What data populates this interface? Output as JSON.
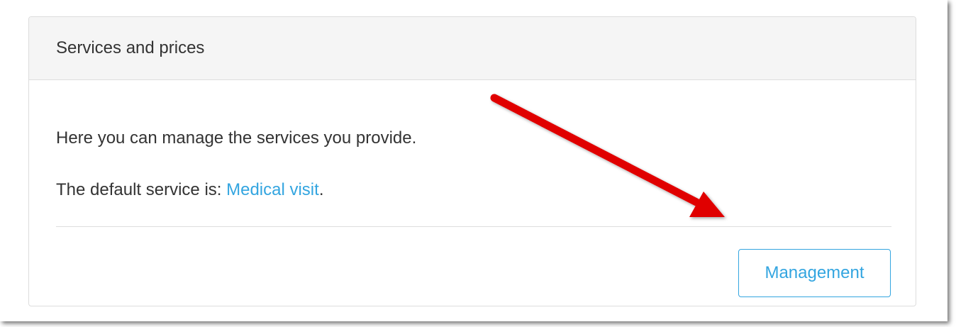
{
  "panel": {
    "title": "Services and prices",
    "description": "Here you can manage the services you provide.",
    "default_service_prefix": "The default service is: ",
    "default_service_link": "Medical visit",
    "default_service_suffix": ".",
    "management_button": "Management"
  },
  "annotation": {
    "type": "arrow",
    "color": "#e00000",
    "points_to": "management_button"
  },
  "colors": {
    "link": "#33a5e0",
    "heading_bg": "#f5f5f5",
    "border": "#dddddd",
    "text": "#333333"
  }
}
